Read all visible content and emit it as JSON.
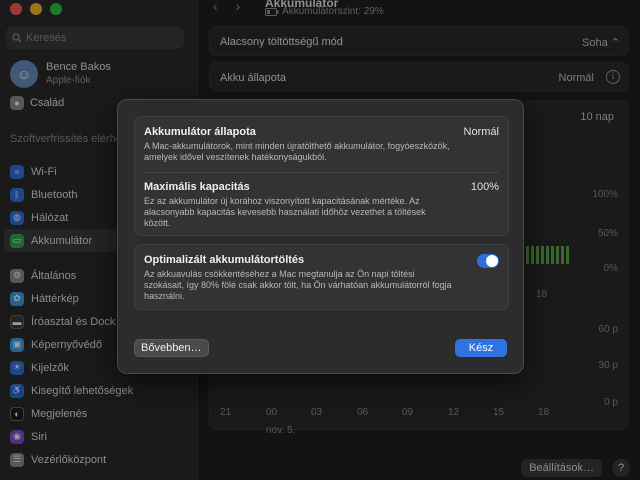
{
  "window": {
    "traffic_colors": [
      "#ff5f57",
      "#febc2e",
      "#28c840"
    ]
  },
  "sidebar": {
    "search_placeholder": "Keresés",
    "profile": {
      "name": "Bence Bakos",
      "subtitle": "Apple-fiók"
    },
    "family_label": "Család",
    "section_label": "Szoftverfrissítés elérhető",
    "items": [
      {
        "label": "Wi-Fi",
        "icon": "wifi-icon",
        "color": "#2f73e0"
      },
      {
        "label": "Bluetooth",
        "icon": "bluetooth-icon",
        "color": "#2f73e0"
      },
      {
        "label": "Hálózat",
        "icon": "globe-icon",
        "color": "#2f73e0"
      },
      {
        "label": "Akkumulátor",
        "icon": "battery-icon",
        "color": "#34a853",
        "active": true
      },
      {
        "label": "Általános",
        "icon": "gear-icon",
        "color": "#8e8e93"
      },
      {
        "label": "Háttérkép",
        "icon": "wallpaper-icon",
        "color": "#3aa0e8"
      },
      {
        "label": "Íróasztal és Dock",
        "icon": "dock-icon",
        "color": "#3a3a3c"
      },
      {
        "label": "Képernyővédő",
        "icon": "screensaver-icon",
        "color": "#3aa0e8"
      },
      {
        "label": "Kijelzők",
        "icon": "sun-icon",
        "color": "#2f73e0"
      },
      {
        "label": "Kisegítő lehetőségek",
        "icon": "accessibility-icon",
        "color": "#2f73e0"
      },
      {
        "label": "Megjelenés",
        "icon": "appearance-icon",
        "color": "#1c1c1e"
      },
      {
        "label": "Siri",
        "icon": "siri-icon",
        "color": "#7b4fd6"
      },
      {
        "label": "Vezérlőközpont",
        "icon": "control-center-icon",
        "color": "#8e8e93"
      }
    ]
  },
  "header": {
    "title": "Akkumulátor",
    "subtitle": "Akkumulátorszint: 29%"
  },
  "settings": {
    "low_power_label": "Alacsony töltöttségű mód",
    "low_power_value": "Soha",
    "health_label": "Akku állapota",
    "health_value": "Normál",
    "range_value": "10 nap"
  },
  "chart": {
    "level_ticks": [
      "100%",
      "50%",
      "0%"
    ],
    "level_x_tick": "18",
    "usage_ticks": [
      "60 p",
      "30 p",
      "0 p"
    ],
    "x_ticks": [
      "21",
      "00",
      "03",
      "06",
      "09",
      "12",
      "15",
      "18"
    ],
    "date_label": "nov. 5.",
    "bar_color": "#5ea64b"
  },
  "footer": {
    "options_label": "Beállítások…",
    "help_label": "?"
  },
  "modal": {
    "health_title": "Akkumulátor állapota",
    "health_value": "Normál",
    "health_desc": "A Mac-akkumulátorok, mint minden újratölthető akkumulátor, fogyóeszközök, amelyek idővel veszítenek hatékonyságukból.",
    "capacity_title": "Maximális kapacitás",
    "capacity_value": "100%",
    "capacity_desc": "Ez az akkumulátor új korához viszonyított kapacitásának mértéke. Az alacsonyabb kapacitás kevesebb használati időhöz vezethet a töltések között.",
    "optimized_title": "Optimalizált akkumulátortöltés",
    "optimized_desc": "Az akkuavulás csökkentéséhez a Mac megtanulja az Ön napi töltési szokásait, így 80% fölé csak akkor tölt, ha Ön várhatóan akkumulátorról fogja használni.",
    "optimized_enabled": true,
    "more_label": "Bővebben…",
    "done_label": "Kész"
  }
}
